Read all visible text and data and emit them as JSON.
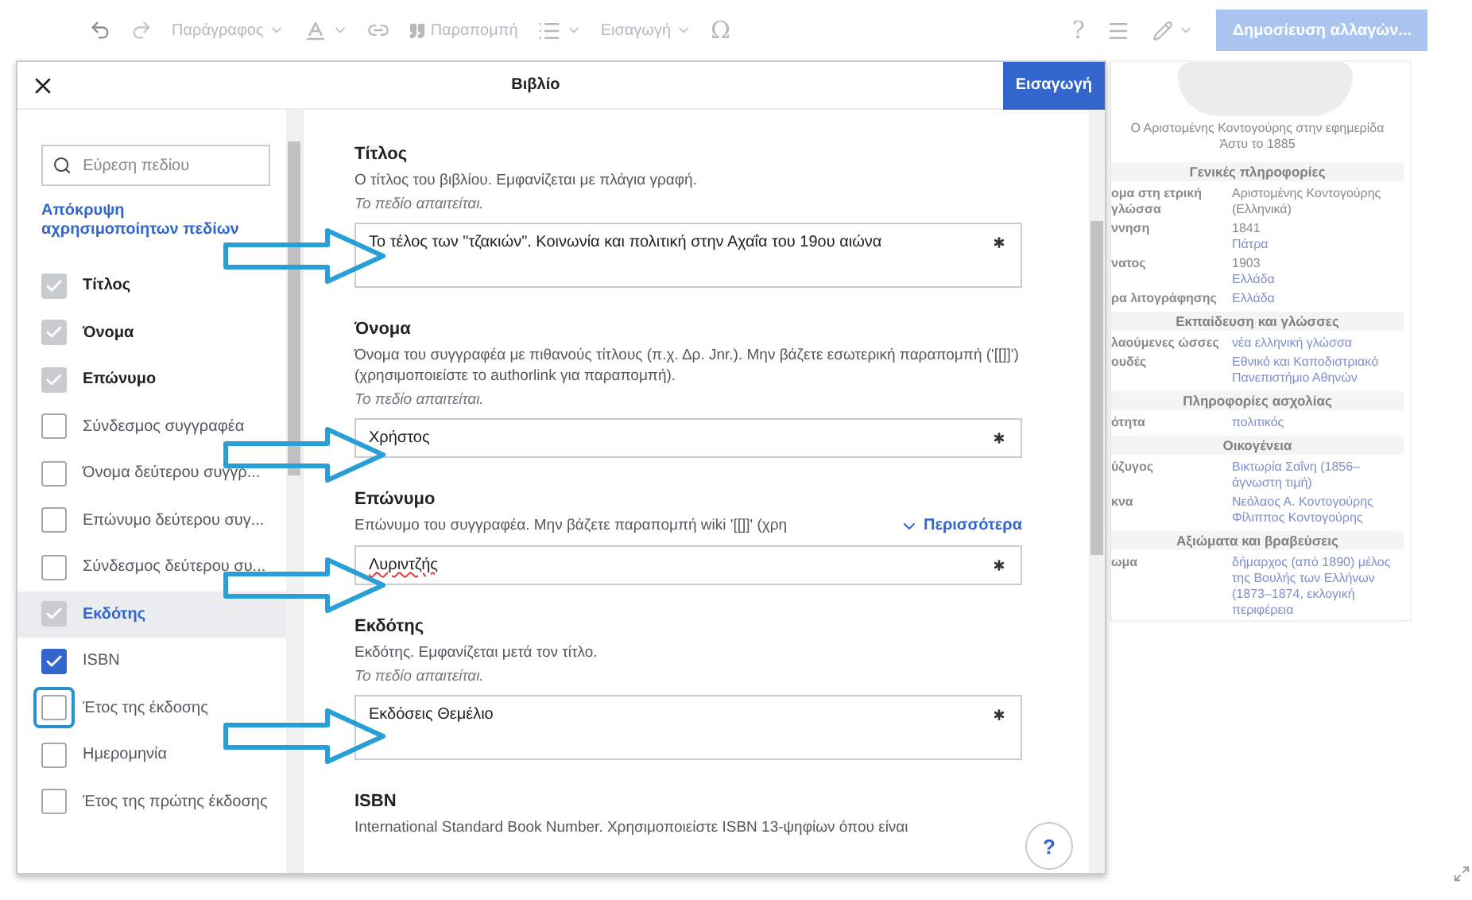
{
  "toolbar": {
    "items": [
      {
        "kind": "undo"
      },
      {
        "kind": "redo"
      },
      {
        "kind": "dropdown",
        "label": "Παράγραφος"
      },
      {
        "kind": "text-style"
      },
      {
        "kind": "link"
      },
      {
        "kind": "cite",
        "label": "Παραπομπή"
      },
      {
        "kind": "list"
      },
      {
        "kind": "dropdown",
        "label": "Εισαγωγή"
      },
      {
        "kind": "char",
        "label": "Ω"
      }
    ],
    "right": [
      {
        "kind": "char",
        "label": "?"
      },
      {
        "kind": "menu"
      },
      {
        "kind": "edit"
      }
    ],
    "publish": "Δημοσίευση αλλαγών..."
  },
  "dialog": {
    "title": "Βιβλίο",
    "action": "Εισαγωγή",
    "sidebar": {
      "search_placeholder": "Εύρεση πεδίου",
      "hide_link": "Απόκρυψη αχρησιμοποίητων πεδίων",
      "fields": [
        {
          "label": "Τίτλος",
          "checked": true,
          "required": true,
          "selected": false,
          "highlighted": false
        },
        {
          "label": "Όνομα",
          "checked": true,
          "required": true,
          "selected": false,
          "highlighted": false
        },
        {
          "label": "Επώνυμο",
          "checked": true,
          "required": true,
          "selected": false,
          "highlighted": false
        },
        {
          "label": "Σύνδεσμος συγγραφέα",
          "checked": false,
          "required": false,
          "selected": false,
          "highlighted": false
        },
        {
          "label": "Όνομα δεύτερου συγγρ...",
          "checked": false,
          "required": false,
          "selected": false,
          "highlighted": false
        },
        {
          "label": "Επώνυμο δεύτερου συγ...",
          "checked": false,
          "required": false,
          "selected": false,
          "highlighted": false
        },
        {
          "label": "Σύνδεσμος δεύτερου συ...",
          "checked": false,
          "required": false,
          "selected": false,
          "highlighted": false
        },
        {
          "label": "Εκδότης",
          "checked": true,
          "required": true,
          "selected": true,
          "highlighted": false
        },
        {
          "label": "ISBN",
          "checked": true,
          "required": false,
          "selected": false,
          "highlighted": false
        },
        {
          "label": "Έτος της έκδοσης",
          "checked": false,
          "required": false,
          "selected": false,
          "highlighted": true
        },
        {
          "label": "Ημερομηνία",
          "checked": false,
          "required": false,
          "selected": false,
          "highlighted": false
        },
        {
          "label": "Έτος της πρώτης έκδοσης",
          "checked": false,
          "required": false,
          "selected": false,
          "highlighted": false
        }
      ]
    },
    "form": [
      {
        "label": "Τίτλος",
        "description": "Ο τίτλος του βιβλίου. Εμφανίζεται με πλάγια γραφή.",
        "note": "Το πεδίο απαιτείται.",
        "value": "Το τέλος των \"τζακιών\". Κοινωνία και πολιτική στην Αχαΐα του 19ου αιώνα",
        "multiline": true,
        "arrow": true
      },
      {
        "label": "Όνομα",
        "description": "Όνομα του συγγραφέα με πιθανούς τίτλους (π.χ. Δρ. Jnr.). Μην βάζετε εσωτερική παραπομπή ('[[]]') (χρησιμοποιείστε το authorlink για παραπομπή).",
        "note": "Το πεδίο απαιτείται.",
        "value": "Χρήστος",
        "multiline": false,
        "arrow": true
      },
      {
        "label": "Επώνυμο",
        "description": "Επώνυμο του συγγραφέα. Μην βάζετε παραπομπή wiki '[[]]' (χρη",
        "more": "Περισσότερα",
        "value": "Λυριντζής",
        "misspelled": true,
        "multiline": false,
        "arrow": true
      },
      {
        "label": "Εκδότης",
        "description": "Εκδότης. Εμφανίζεται μετά τον τίτλο.",
        "note": "Το πεδίο απαιτείται.",
        "value": "Εκδόσεις Θεμέλιο",
        "multiline": true,
        "arrow": true
      },
      {
        "label": "ISBN",
        "description": "International Standard Book Number. Χρησιμοποιείστε ISBN 13-ψηφίων όπου είναι"
      }
    ],
    "help": "?"
  },
  "infobox": {
    "caption": "Ο Αριστομένης Κοντογούρης στην εφημερίδα Άστυ το 1885",
    "rows": [
      {
        "kind": "header",
        "text": "Γενικές πληροφορίες"
      },
      {
        "kind": "row",
        "label": "ομα στη ετρική γλώσσα",
        "value": "Αριστομένης Κοντογούρης (Ελληνικά)"
      },
      {
        "kind": "row",
        "label": "ννηση",
        "value": "1841",
        "link": "Πάτρα"
      },
      {
        "kind": "row",
        "label": "νατος",
        "value": "1903",
        "link": "Ελλάδα"
      },
      {
        "kind": "row",
        "label": "ρα λιτογράφησης",
        "link": "Ελλάδα"
      },
      {
        "kind": "header",
        "text": "Εκπαίδευση και γλώσσες"
      },
      {
        "kind": "row",
        "label": "λαούμενες ώσσες",
        "link": "νέα ελληνική γλώσσα"
      },
      {
        "kind": "row",
        "label": "ουδές",
        "link": "Εθνικό και Καποδιστριακό Πανεπιστήμιο Αθηνών"
      },
      {
        "kind": "header",
        "text": "Πληροφορίες ασχολίας"
      },
      {
        "kind": "row",
        "label": "ότητα",
        "link": "πολιτικός"
      },
      {
        "kind": "header",
        "text": "Οικογένεια"
      },
      {
        "kind": "row",
        "label": "ύζυγος",
        "link": "Βικτωρία Σαΐνη (1856–άγνωστη τιμή)"
      },
      {
        "kind": "row",
        "label": "κνα",
        "link": "Νεόλαος Α. Κοντογούρης Φίλιππος Κοντογούρης"
      },
      {
        "kind": "header",
        "text": "Αξιώματα και βραβεύσεις"
      },
      {
        "kind": "row",
        "label": "ωμα",
        "link": "δήμαρχος (από 1890) μέλος της Βουλής των Ελλήνων (1873–1874, εκλογική περιφέρεια"
      }
    ]
  }
}
